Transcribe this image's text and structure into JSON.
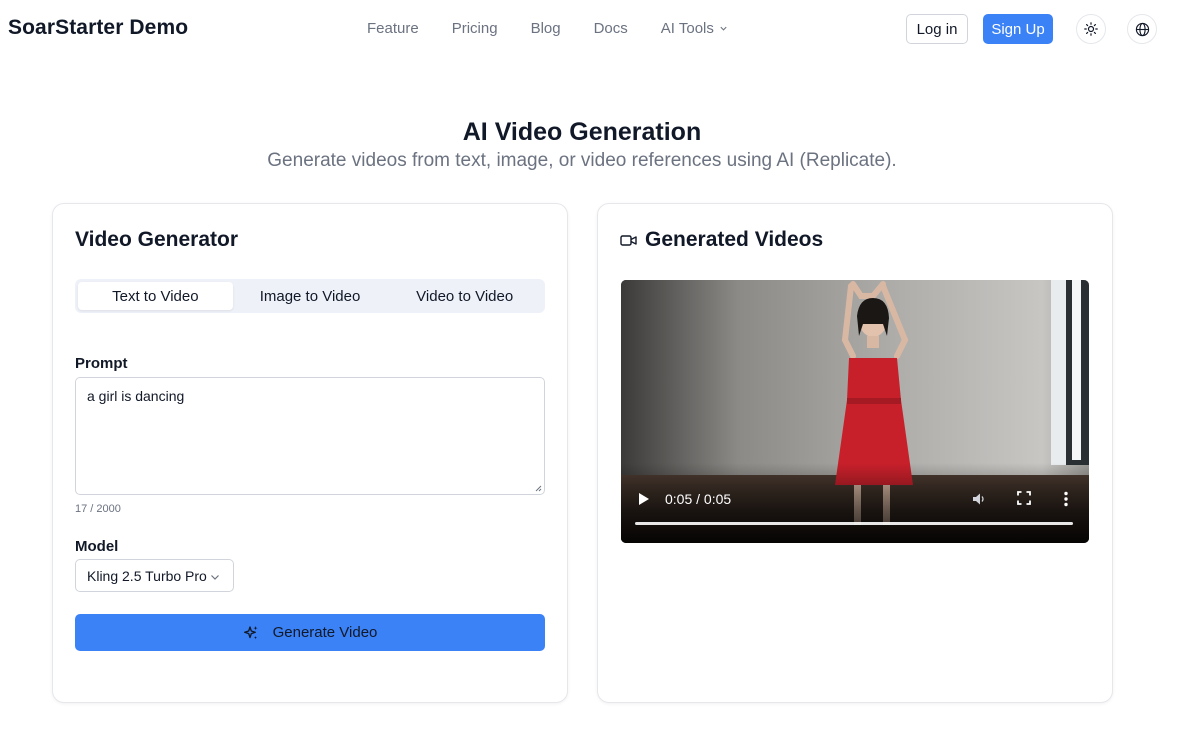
{
  "header": {
    "brand": "SoarStarter Demo",
    "nav": [
      "Feature",
      "Pricing",
      "Blog",
      "Docs",
      "AI Tools"
    ],
    "login_label": "Log in",
    "signup_label": "Sign Up",
    "theme_icon": "sun-icon",
    "lang_icon": "globe-icon"
  },
  "hero": {
    "title": "AI Video Generation",
    "subtitle": "Generate videos from text, image, or video references using AI (Replicate)."
  },
  "generator": {
    "title": "Video Generator",
    "tabs": [
      {
        "label": "Text to Video",
        "active": true
      },
      {
        "label": "Image to Video",
        "active": false
      },
      {
        "label": "Video to Video",
        "active": false
      }
    ],
    "prompt_label": "Prompt",
    "prompt_value": "a girl is dancing",
    "char_count": "17 / 2000",
    "model_label": "Model",
    "model_value": "Kling 2.5 Turbo Pro",
    "generate_label": "Generate Video"
  },
  "results": {
    "title": "Generated Videos",
    "video": {
      "time": "0:05 / 0:05",
      "progress": 1.0
    }
  },
  "colors": {
    "accent": "#3b82f6",
    "text": "#111827",
    "muted": "#6b7280",
    "border": "#e5e7eb"
  }
}
